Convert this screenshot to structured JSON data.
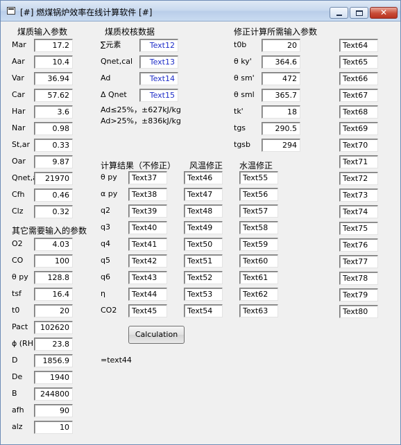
{
  "window": {
    "title": "[#] 燃煤锅炉效率在线计算软件 [#]"
  },
  "section1": {
    "title": "煤质输入参数",
    "rows": [
      {
        "label": "Mar",
        "value": "17.2"
      },
      {
        "label": "Aar",
        "value": "10.4"
      },
      {
        "label": "Var",
        "value": "36.94"
      },
      {
        "label": "Car",
        "value": "57.62"
      },
      {
        "label": "Har",
        "value": "3.6"
      },
      {
        "label": "Nar",
        "value": "0.98"
      },
      {
        "label": "St,ar",
        "value": "0.33"
      },
      {
        "label": "Oar",
        "value": "9.87"
      },
      {
        "label": "Qnet,a",
        "value": "21970"
      },
      {
        "label": "Cfh",
        "value": "0.46"
      },
      {
        "label": "Clz",
        "value": "0.32"
      }
    ]
  },
  "section2": {
    "title": "其它需要输入的参数",
    "rows": [
      {
        "label": "O2",
        "value": "4.03"
      },
      {
        "label": "CO",
        "value": "100"
      },
      {
        "label": "θ py",
        "value": "128.8"
      },
      {
        "label": "tsf",
        "value": "16.4"
      },
      {
        "label": "t0",
        "value": "20"
      },
      {
        "label": "Pact",
        "value": "102620"
      },
      {
        "label": "ϕ (RH",
        "value": "23.8"
      },
      {
        "label": "D",
        "value": "1856.9"
      },
      {
        "label": "De",
        "value": "1940"
      },
      {
        "label": "B",
        "value": "244800"
      },
      {
        "label": "afh",
        "value": "90"
      },
      {
        "label": "alz",
        "value": "10"
      }
    ]
  },
  "check": {
    "title": "煤质校核数据",
    "rows": [
      {
        "label": "∑元素",
        "value": "Text12"
      },
      {
        "label": "Qnet,cal",
        "value": "Text13"
      },
      {
        "label": "Ad",
        "value": "Text14"
      },
      {
        "label": "Δ Qnet",
        "value": "Text15"
      }
    ],
    "note1": "Ad≤25%，±627kJ/kg",
    "note2": "Ad>25%，±836kJ/kg"
  },
  "results": {
    "title": "计算结果（不修正）",
    "col_wind": "风温修正",
    "col_water": "水温修正",
    "rows": [
      {
        "label": "θ py",
        "v1": "Text37",
        "v2": "Text46",
        "v3": "Text55"
      },
      {
        "label": "α py",
        "v1": "Text38",
        "v2": "Text47",
        "v3": "Text56"
      },
      {
        "label": "q2",
        "v1": "Text39",
        "v2": "Text48",
        "v3": "Text57"
      },
      {
        "label": "q3",
        "v1": "Text40",
        "v2": "Text49",
        "v3": "Text58"
      },
      {
        "label": "q4",
        "v1": "Text41",
        "v2": "Text50",
        "v3": "Text59"
      },
      {
        "label": "q5",
        "v1": "Text42",
        "v2": "Text51",
        "v3": "Text60"
      },
      {
        "label": "q6",
        "v1": "Text43",
        "v2": "Text52",
        "v3": "Text61"
      },
      {
        "label": "η",
        "v1": "Text44",
        "v2": "Text53",
        "v3": "Text62"
      },
      {
        "label": "CO2",
        "v1": "Text45",
        "v2": "Text54",
        "v3": "Text63"
      }
    ]
  },
  "calc_button": "Calculation",
  "output_text": "=text44",
  "correction": {
    "title": "修正计算所需输入参数",
    "rows": [
      {
        "label": "t0b",
        "value": "20"
      },
      {
        "label": "θ ky'",
        "value": "364.6"
      },
      {
        "label": "θ sm'",
        "value": "472"
      },
      {
        "label": "θ sml",
        "value": "365.7"
      },
      {
        "label": "tk'",
        "value": "18"
      },
      {
        "label": "tgs",
        "value": "290.5"
      },
      {
        "label": "tgsb",
        "value": "294"
      }
    ]
  },
  "right_column": [
    "Text64",
    "Text65",
    "Text66",
    "Text67",
    "Text68",
    "Text69",
    "Text70",
    "Text71",
    "Text72",
    "Text73",
    "Text74",
    "Text75",
    "Text76",
    "Text77",
    "Text78",
    "Text79",
    "Text80"
  ]
}
